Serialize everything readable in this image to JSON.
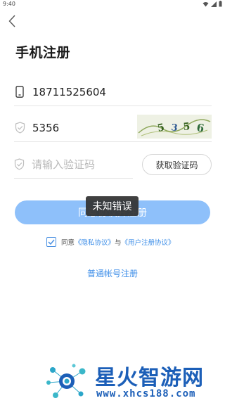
{
  "status_bar": {
    "time": "9:40"
  },
  "page": {
    "title": "手机注册"
  },
  "form": {
    "phone_value": "18711525604",
    "captcha_value": "5356",
    "sms_placeholder": "请输入验证码",
    "sms_button_label": "获取验证码",
    "submit_label": "同意协议并注册"
  },
  "toast": {
    "message": "未知错误"
  },
  "agreement": {
    "checked": true,
    "prefix": "同意",
    "privacy_link": "《隐私协议》",
    "conjunction": "与",
    "user_link": "《用户注册协议》"
  },
  "alt_register": {
    "label": "普通帐号注册"
  },
  "watermark": {
    "title": "星火智游网",
    "url": "www.xhcs188.com"
  },
  "colors": {
    "accent": "#3d8ee8",
    "submit_bg": "#8ec0fa",
    "toast_bg": "#323232",
    "watermark": "#1c5fb8"
  }
}
